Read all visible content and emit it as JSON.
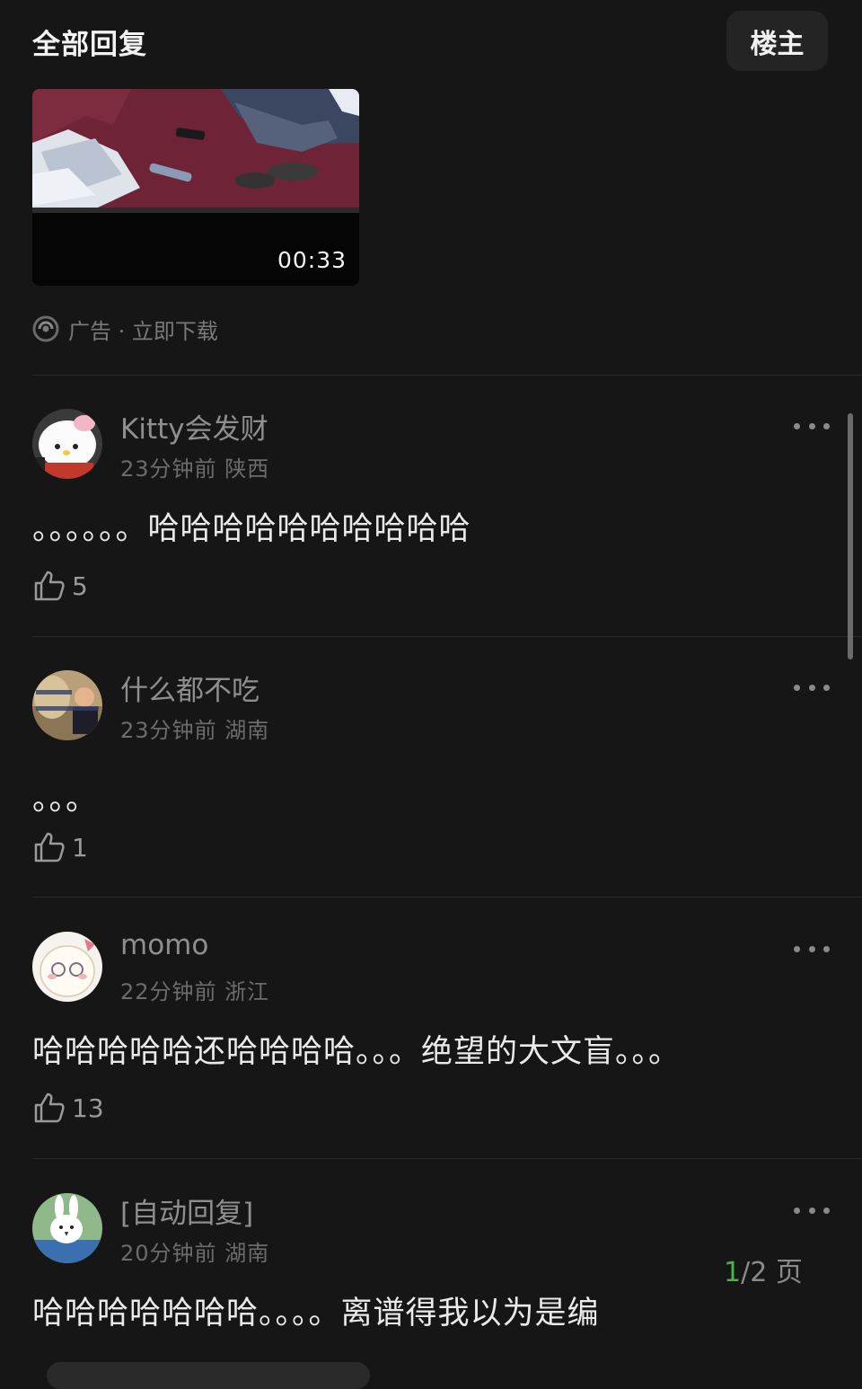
{
  "header": {
    "title": "全部回复",
    "owner_button": "楼主"
  },
  "video": {
    "duration": "00:33"
  },
  "ad": {
    "label": "广告 · 立即下载"
  },
  "comments": [
    {
      "username": "Kitty会发财",
      "time": "23分钟前",
      "location": "陕西",
      "text": "。。。。。。哈哈哈哈哈哈哈哈哈哈",
      "likes": "5"
    },
    {
      "username": "什么都不吃",
      "time": "23分钟前",
      "location": "湖南",
      "text": "。。。",
      "likes": "1"
    },
    {
      "username": "momo",
      "time": "22分钟前",
      "location": "浙江",
      "text": "哈哈哈哈哈还哈哈哈哈。。。绝望的大文盲。。。",
      "likes": "13"
    },
    {
      "username": "[自动回复]",
      "time": "20分钟前",
      "location": "湖南",
      "text": "哈哈哈哈哈哈哈。。。。离谱得我以为是编",
      "likes": ""
    }
  ],
  "pager": {
    "current": "1",
    "total_suffix": "/2 页"
  }
}
